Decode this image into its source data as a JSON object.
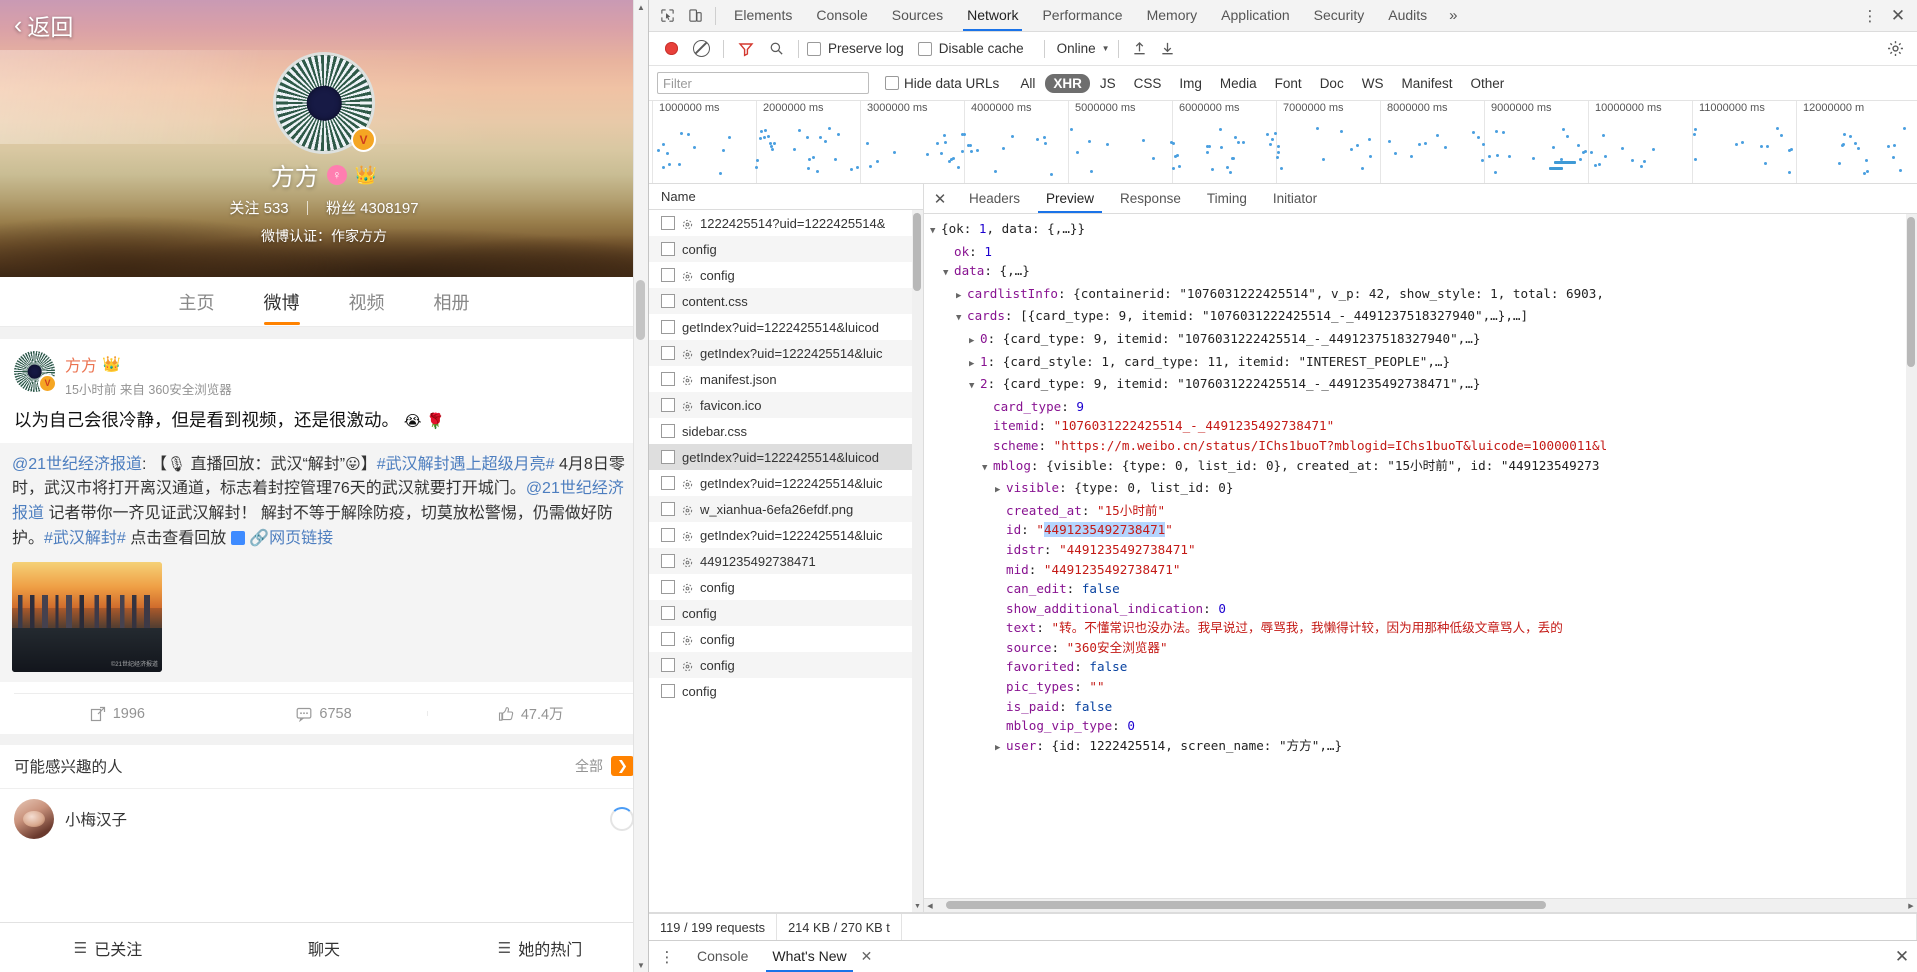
{
  "weibo": {
    "back_label": "返回",
    "profile": {
      "name": "方方",
      "follow_label": "关注",
      "follow_count": "533",
      "fans_label": "粉丝",
      "fans_count": "4308197",
      "verify_text": "微博认证：作家方方",
      "verified_badge": "V",
      "gender_icon": "female-icon",
      "crown_icon": "vip-crown-icon"
    },
    "tabs": [
      {
        "label": "主页",
        "active": false
      },
      {
        "label": "微博",
        "active": true
      },
      {
        "label": "视频",
        "active": false
      },
      {
        "label": "相册",
        "active": false
      }
    ],
    "post": {
      "author": "方方",
      "time": "15小时前",
      "source_prefix": "来自",
      "source": "360安全浏览器",
      "text": "以为自己会很冷静，但是看到视频，还是很激动。",
      "text_emoji_1": "😭",
      "text_emoji_2": "🌹",
      "quote": {
        "mention": "@21世纪经济报道",
        "line1_a": ": 【",
        "mic_icon": "🎙",
        "line1_b": " 直播回放：武汉“解封”",
        "line1_emoji": "😛",
        "line1_c": "】",
        "tag1": "#武汉解封遇上超级月亮#",
        "body": " 4月8日零时，武汉市将打开离汉通道，标志着封控管理76天的武汉就要打开城门。",
        "mention2": "@21世纪经济报道",
        "body2": " 记者带你一齐见证武汉解封！ 解封不等于解除防疫，切莫放松警惕，仍需做好防护。",
        "tag2": "#武汉解封#",
        "body3": " 点击查看回放",
        "link_label": "网页链接",
        "image_watermark": "©21世纪经济报道"
      }
    },
    "actions": [
      {
        "icon": "repost-icon",
        "count": "1996"
      },
      {
        "icon": "comment-icon",
        "count": "6758"
      },
      {
        "icon": "like-icon",
        "count": "47.4万"
      }
    ],
    "interest": {
      "title": "可能感兴趣的人",
      "all_label": "全部",
      "arrow_icon": "chevron-right-icon",
      "rows": [
        {
          "name": "小梅汉子"
        }
      ]
    },
    "bottom_nav": [
      {
        "icon": "list-icon",
        "label": "已关注"
      },
      {
        "icon": "chat-icon",
        "label": "聊天"
      },
      {
        "icon": "hot-icon",
        "label": "她的热门"
      }
    ]
  },
  "devtools": {
    "toolbar_icons": [
      "inspect-icon",
      "device-toggle-icon"
    ],
    "panels": [
      {
        "label": "Elements",
        "active": false
      },
      {
        "label": "Console",
        "active": false
      },
      {
        "label": "Sources",
        "active": false
      },
      {
        "label": "Network",
        "active": true
      },
      {
        "label": "Performance",
        "active": false
      },
      {
        "label": "Memory",
        "active": false
      },
      {
        "label": "Application",
        "active": false
      },
      {
        "label": "Security",
        "active": false
      },
      {
        "label": "Audits",
        "active": false
      }
    ],
    "overflow_label": "»",
    "more_icon": "kebab-menu-icon",
    "close_icon": "close-icon",
    "network_toolbar": {
      "record_icon": "record-button",
      "clear_icon": "clear-icon",
      "filter_icon": "funnel-icon",
      "search_icon": "search-icon",
      "preserve_log": "Preserve log",
      "disable_cache": "Disable cache",
      "throttling": "Online",
      "import_icon": "upload-icon",
      "export_icon": "download-icon",
      "settings_icon": "gear-icon"
    },
    "filter_bar": {
      "placeholder": "Filter",
      "value": "",
      "hide_data_urls": "Hide data URLs",
      "types": [
        {
          "label": "All",
          "active": false
        },
        {
          "label": "XHR",
          "active": true
        },
        {
          "label": "JS",
          "active": false
        },
        {
          "label": "CSS",
          "active": false
        },
        {
          "label": "Img",
          "active": false
        },
        {
          "label": "Media",
          "active": false
        },
        {
          "label": "Font",
          "active": false
        },
        {
          "label": "Doc",
          "active": false
        },
        {
          "label": "WS",
          "active": false
        },
        {
          "label": "Manifest",
          "active": false
        },
        {
          "label": "Other",
          "active": false
        }
      ]
    },
    "timeline_ticks": [
      "1000000 ms",
      "2000000 ms",
      "3000000 ms",
      "4000000 ms",
      "5000000 ms",
      "6000000 ms",
      "7000000 ms",
      "8000000 ms",
      "9000000 ms",
      "10000000 ms",
      "11000000 ms",
      "12000000 m"
    ],
    "requests": {
      "column_header": "Name",
      "rows": [
        {
          "name": "1222425514?uid=1222425514&",
          "has_icon": true,
          "selected": false
        },
        {
          "name": "config",
          "has_icon": false,
          "selected": false
        },
        {
          "name": "config",
          "has_icon": true,
          "selected": false
        },
        {
          "name": "content.css",
          "has_icon": false,
          "selected": false
        },
        {
          "name": "getIndex?uid=1222425514&luicod",
          "has_icon": false,
          "selected": false
        },
        {
          "name": "getIndex?uid=1222425514&luic",
          "has_icon": true,
          "selected": false
        },
        {
          "name": "manifest.json",
          "has_icon": true,
          "selected": false
        },
        {
          "name": "favicon.ico",
          "has_icon": true,
          "selected": false
        },
        {
          "name": "sidebar.css",
          "has_icon": false,
          "selected": false
        },
        {
          "name": "getIndex?uid=1222425514&luicod",
          "has_icon": false,
          "selected": true
        },
        {
          "name": "getIndex?uid=1222425514&luic",
          "has_icon": true,
          "selected": false
        },
        {
          "name": "w_xianhua-6efa26efdf.png",
          "has_icon": true,
          "selected": false
        },
        {
          "name": "getIndex?uid=1222425514&luic",
          "has_icon": true,
          "selected": false
        },
        {
          "name": "4491235492738471",
          "has_icon": true,
          "selected": false
        },
        {
          "name": "config",
          "has_icon": true,
          "selected": false
        },
        {
          "name": "config",
          "has_icon": false,
          "selected": false
        },
        {
          "name": "config",
          "has_icon": true,
          "selected": false
        },
        {
          "name": "config",
          "has_icon": true,
          "selected": false
        },
        {
          "name": "config",
          "has_icon": false,
          "selected": false
        }
      ]
    },
    "detail_tabs": [
      {
        "label": "Headers",
        "active": false
      },
      {
        "label": "Preview",
        "active": true
      },
      {
        "label": "Response",
        "active": false
      },
      {
        "label": "Timing",
        "active": false
      },
      {
        "label": "Initiator",
        "active": false
      }
    ],
    "preview_json": [
      {
        "indent": 0,
        "tri": "▼",
        "parts": [
          {
            "t": "plain",
            "v": "{ok: "
          },
          {
            "t": "n",
            "v": "1"
          },
          {
            "t": "plain",
            "v": ", data: {,…}}"
          }
        ]
      },
      {
        "indent": 1,
        "tri": "",
        "parts": [
          {
            "t": "k",
            "v": "ok"
          },
          {
            "t": "plain",
            "v": ": "
          },
          {
            "t": "n",
            "v": "1"
          }
        ]
      },
      {
        "indent": 1,
        "tri": "▼",
        "parts": [
          {
            "t": "k",
            "v": "data"
          },
          {
            "t": "plain",
            "v": ": {,…}"
          }
        ]
      },
      {
        "indent": 2,
        "tri": "▶",
        "parts": [
          {
            "t": "k",
            "v": "cardlistInfo"
          },
          {
            "t": "plain",
            "v": ": {containerid: \"1076031222425514\", v_p: 42, show_style: 1, total: 6903,"
          }
        ]
      },
      {
        "indent": 2,
        "tri": "▼",
        "parts": [
          {
            "t": "k",
            "v": "cards"
          },
          {
            "t": "plain",
            "v": ": [{card_type: 9, itemid: \"1076031222425514_-_4491237518327940\",…},…]"
          }
        ]
      },
      {
        "indent": 3,
        "tri": "▶",
        "parts": [
          {
            "t": "k",
            "v": "0"
          },
          {
            "t": "plain",
            "v": ": {card_type: 9, itemid: \"1076031222425514_-_4491237518327940\",…}"
          }
        ]
      },
      {
        "indent": 3,
        "tri": "▶",
        "parts": [
          {
            "t": "k",
            "v": "1"
          },
          {
            "t": "plain",
            "v": ": {card_style: 1, card_type: 11, itemid: \"INTEREST_PEOPLE\",…}"
          }
        ]
      },
      {
        "indent": 3,
        "tri": "▼",
        "parts": [
          {
            "t": "k",
            "v": "2"
          },
          {
            "t": "plain",
            "v": ": {card_type: 9, itemid: \"1076031222425514_-_4491235492738471\",…}"
          }
        ]
      },
      {
        "indent": 4,
        "tri": "",
        "parts": [
          {
            "t": "k",
            "v": "card_type"
          },
          {
            "t": "plain",
            "v": ": "
          },
          {
            "t": "n",
            "v": "9"
          }
        ]
      },
      {
        "indent": 4,
        "tri": "",
        "parts": [
          {
            "t": "k",
            "v": "itemid"
          },
          {
            "t": "plain",
            "v": ": "
          },
          {
            "t": "s",
            "v": "\"1076031222425514_-_4491235492738471\""
          }
        ]
      },
      {
        "indent": 4,
        "tri": "",
        "parts": [
          {
            "t": "k",
            "v": "scheme"
          },
          {
            "t": "plain",
            "v": ": "
          },
          {
            "t": "s",
            "v": "\"https://m.weibo.cn/status/IChs1buoT?mblogid=IChs1buoT&luicode=10000011&l"
          }
        ]
      },
      {
        "indent": 4,
        "tri": "▼",
        "parts": [
          {
            "t": "k",
            "v": "mblog"
          },
          {
            "t": "plain",
            "v": ": {visible: {type: 0, list_id: 0}, created_at: \"15小时前\", id: \"449123549273"
          }
        ]
      },
      {
        "indent": 5,
        "tri": "▶",
        "parts": [
          {
            "t": "k",
            "v": "visible"
          },
          {
            "t": "plain",
            "v": ": {type: 0, list_id: 0}"
          }
        ]
      },
      {
        "indent": 5,
        "tri": "",
        "parts": [
          {
            "t": "k",
            "v": "created_at"
          },
          {
            "t": "plain",
            "v": ": "
          },
          {
            "t": "s",
            "v": "\"15小时前\""
          }
        ]
      },
      {
        "indent": 5,
        "tri": "",
        "parts": [
          {
            "t": "k",
            "v": "id"
          },
          {
            "t": "plain",
            "v": ": "
          },
          {
            "t": "s",
            "v": "\""
          },
          {
            "t": "hl",
            "v": "4491235492738471"
          },
          {
            "t": "s",
            "v": "\""
          }
        ]
      },
      {
        "indent": 5,
        "tri": "",
        "parts": [
          {
            "t": "k",
            "v": "idstr"
          },
          {
            "t": "plain",
            "v": ": "
          },
          {
            "t": "s",
            "v": "\"4491235492738471\""
          }
        ]
      },
      {
        "indent": 5,
        "tri": "",
        "parts": [
          {
            "t": "k",
            "v": "mid"
          },
          {
            "t": "plain",
            "v": ": "
          },
          {
            "t": "s",
            "v": "\"4491235492738471\""
          }
        ]
      },
      {
        "indent": 5,
        "tri": "",
        "parts": [
          {
            "t": "k",
            "v": "can_edit"
          },
          {
            "t": "plain",
            "v": ": "
          },
          {
            "t": "b",
            "v": "false"
          }
        ]
      },
      {
        "indent": 5,
        "tri": "",
        "parts": [
          {
            "t": "k",
            "v": "show_additional_indication"
          },
          {
            "t": "plain",
            "v": ": "
          },
          {
            "t": "n",
            "v": "0"
          }
        ]
      },
      {
        "indent": 5,
        "tri": "",
        "parts": [
          {
            "t": "k",
            "v": "text"
          },
          {
            "t": "plain",
            "v": ": "
          },
          {
            "t": "s",
            "v": "\"转。不懂常识也没办法。我早说过，辱骂我，我懒得计较，因为用那种低级文章骂人，丢的"
          }
        ]
      },
      {
        "indent": 5,
        "tri": "",
        "parts": [
          {
            "t": "k",
            "v": "source"
          },
          {
            "t": "plain",
            "v": ": "
          },
          {
            "t": "s",
            "v": "\"360安全浏览器\""
          }
        ]
      },
      {
        "indent": 5,
        "tri": "",
        "parts": [
          {
            "t": "k",
            "v": "favorited"
          },
          {
            "t": "plain",
            "v": ": "
          },
          {
            "t": "b",
            "v": "false"
          }
        ]
      },
      {
        "indent": 5,
        "tri": "",
        "parts": [
          {
            "t": "k",
            "v": "pic_types"
          },
          {
            "t": "plain",
            "v": ": "
          },
          {
            "t": "s",
            "v": "\"\""
          }
        ]
      },
      {
        "indent": 5,
        "tri": "",
        "parts": [
          {
            "t": "k",
            "v": "is_paid"
          },
          {
            "t": "plain",
            "v": ": "
          },
          {
            "t": "b",
            "v": "false"
          }
        ]
      },
      {
        "indent": 5,
        "tri": "",
        "parts": [
          {
            "t": "k",
            "v": "mblog_vip_type"
          },
          {
            "t": "plain",
            "v": ": "
          },
          {
            "t": "n",
            "v": "0"
          }
        ]
      },
      {
        "indent": 5,
        "tri": "▶",
        "parts": [
          {
            "t": "k",
            "v": "user"
          },
          {
            "t": "plain",
            "v": ": {id: 1222425514, screen_name: \"方方\",…}"
          }
        ]
      }
    ],
    "status": {
      "requests": "119 / 199 requests",
      "transferred": "214 KB / 270 KB t"
    },
    "drawer": {
      "more_icon": "kebab-menu-icon",
      "tabs": [
        {
          "label": "Console",
          "active": false
        },
        {
          "label": "What's New",
          "active": true
        }
      ],
      "tab_close": "✕",
      "close_icon": "close-icon"
    }
  }
}
